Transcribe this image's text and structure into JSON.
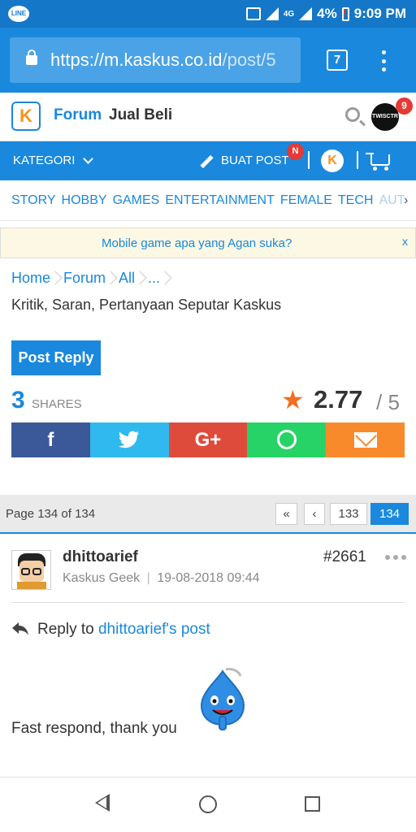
{
  "status_bar": {
    "app_icon_label": "LINE",
    "network": "4G",
    "battery": "4%",
    "time": "9:09 PM"
  },
  "browser": {
    "url_main": "https://m.kaskus.co.id",
    "url_rest": "/post/5",
    "tab_count": "7"
  },
  "header": {
    "logo_letter": "K",
    "forum_label": "Forum",
    "jual_beli_label": "Jual Beli",
    "avatar_text": "TWISCTR",
    "notification_count": "9"
  },
  "navbar": {
    "kategori_label": "KATEGORI",
    "buat_post_label": "BUAT POST",
    "buat_post_badge": "N",
    "coin_letter": "K"
  },
  "categories": {
    "items": [
      "STORY",
      "HOBBY",
      "GAMES",
      "ENTERTAINMENT",
      "FEMALE",
      "TECH"
    ],
    "partial_item": "AUT",
    "more_symbol": "›"
  },
  "notice": {
    "text": "Mobile game apa yang Agan suka?",
    "close": "x"
  },
  "breadcrumb": {
    "items": [
      "Home",
      "Forum",
      "All",
      "..."
    ]
  },
  "thread": {
    "title": "Kritik, Saran, Pertanyaan Seputar Kaskus",
    "post_reply_label": "Post Reply",
    "shares_count": "3",
    "shares_label": "SHARES",
    "rating": "2.77",
    "rating_max": "/ 5"
  },
  "share_buttons": {
    "facebook": "f",
    "google_plus": "G+"
  },
  "pagination": {
    "info": "Page 134 of 134",
    "first": "«",
    "prev": "‹",
    "pages": [
      "133",
      "134"
    ],
    "current": "134"
  },
  "post": {
    "username": "dhittoarief",
    "rank": "Kaskus Geek",
    "date": "19-08-2018 09:44",
    "number": "#2661",
    "reply_prefix": "Reply to",
    "reply_target": "dhittoarief's post",
    "body": "Fast respond, thank you"
  },
  "colors": {
    "brand_blue": "#1a88dd",
    "status_blue": "#1477c7",
    "accent_orange": "#f26f21",
    "badge_red": "#e53935"
  }
}
